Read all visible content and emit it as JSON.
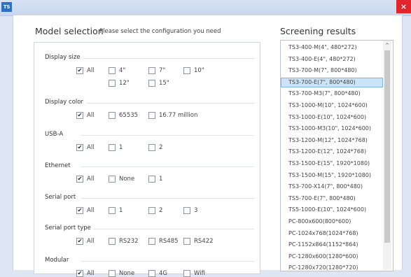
{
  "app": {
    "icon_text": "TS",
    "close_glyph": "×"
  },
  "model_selection": {
    "title": "Model selection",
    "hint": "Please select the configuration you need"
  },
  "screening": {
    "title": "Screening results"
  },
  "groups": [
    {
      "title": "Display size",
      "options": [
        {
          "label": "All",
          "checked": true
        },
        {
          "label": "4\"",
          "checked": false
        },
        {
          "label": "7\"",
          "checked": false
        },
        {
          "label": "10\"",
          "checked": false
        },
        {
          "label": "12\"",
          "checked": false
        },
        {
          "label": "15\"",
          "checked": false
        }
      ]
    },
    {
      "title": "Display color",
      "options": [
        {
          "label": "All",
          "checked": true
        },
        {
          "label": "65535",
          "checked": false
        },
        {
          "label": "16.77 million",
          "checked": false
        }
      ]
    },
    {
      "title": "USB-A",
      "options": [
        {
          "label": "All",
          "checked": true
        },
        {
          "label": "1",
          "checked": false
        },
        {
          "label": "2",
          "checked": false
        }
      ]
    },
    {
      "title": "Ethernet",
      "options": [
        {
          "label": "All",
          "checked": true
        },
        {
          "label": "None",
          "checked": false
        },
        {
          "label": "1",
          "checked": false
        }
      ]
    },
    {
      "title": "Serial port",
      "options": [
        {
          "label": "All",
          "checked": true
        },
        {
          "label": "1",
          "checked": false
        },
        {
          "label": "2",
          "checked": false
        },
        {
          "label": "3",
          "checked": false
        }
      ]
    },
    {
      "title": "Serial port type",
      "options": [
        {
          "label": "All",
          "checked": true
        },
        {
          "label": "RS232",
          "checked": false
        },
        {
          "label": "RS485",
          "checked": false
        },
        {
          "label": "RS422",
          "checked": false
        }
      ]
    },
    {
      "title": "Modular",
      "options": [
        {
          "label": "All",
          "checked": true
        },
        {
          "label": "None",
          "checked": false
        },
        {
          "label": "4G",
          "checked": false
        },
        {
          "label": "Wifi",
          "checked": false
        }
      ]
    }
  ],
  "results": {
    "selected_index": 3,
    "items": [
      "TS3-400-M(4\", 480*272)",
      "TS3-400-E(4\", 480*272)",
      "TS3-700-M(7\", 800*480)",
      "TS3-700-E(7\", 800*480)",
      "TS3-700-M3(7\", 800*480)",
      "TS3-1000-M(10\", 1024*600)",
      "TS3-1000-E(10\", 1024*600)",
      "TS3-1000-M3(10\", 1024*600)",
      "TS3-1200-M(12\", 1024*768)",
      "TS3-1200-E(12\", 1024*768)",
      "TS3-1500-E(15\", 1920*1080)",
      "TS3-1500-M(15\", 1920*1080)",
      "TS3-700-X14(7\", 800*480)",
      "TS5-700-E(7\", 800*480)",
      "TS5-1000-E(10\", 1024*600)",
      "PC-800x600(800*600)",
      "PC-1024x768(1024*768)",
      "PC-1152x864(1152*864)",
      "PC-1280x600(1280*600)",
      "PC-1280x720(1280*720)"
    ]
  },
  "scrollbar": {
    "up_glyph": "^"
  },
  "colors": {
    "selected_bg": "#cce4f7",
    "close_bg": "#e0262b",
    "titlebar_bg": "#c9d7ee"
  }
}
